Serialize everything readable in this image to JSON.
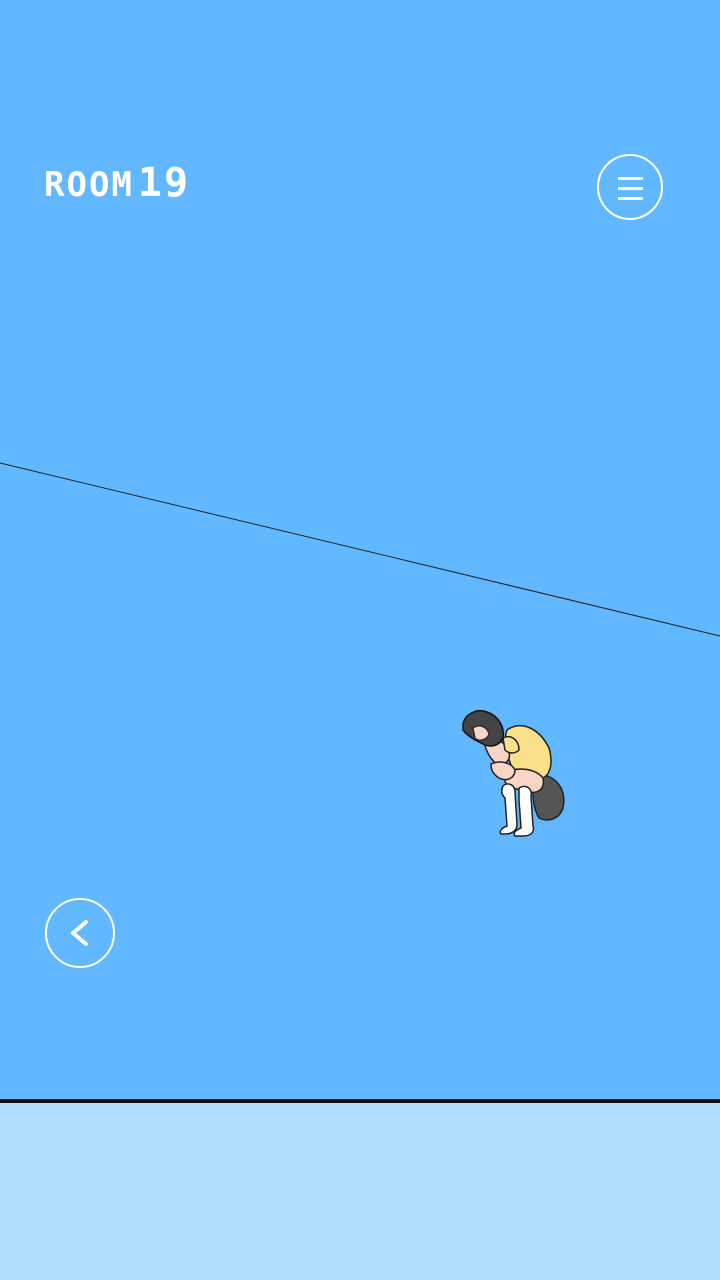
{
  "header": {
    "room_word": "ROOM",
    "room_number": "19"
  },
  "colors": {
    "sky": "#62b8ff",
    "floor": "#b1ddff",
    "ui_white": "#ffffff"
  },
  "icons": {
    "menu": "hamburger-menu-icon",
    "back": "chevron-left-icon"
  }
}
